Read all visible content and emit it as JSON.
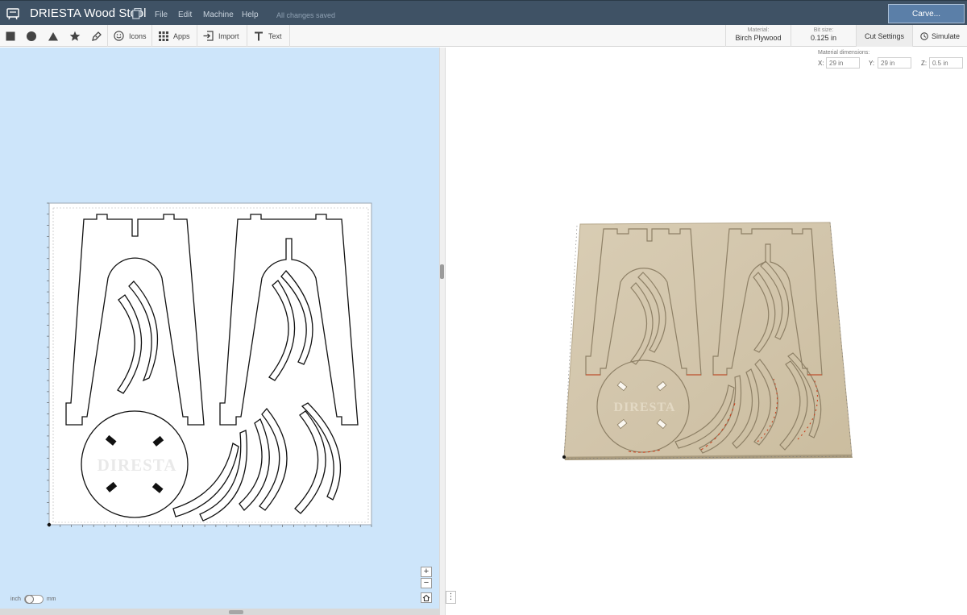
{
  "app": {
    "title": "DRIESTA Wood Stool",
    "status": "All changes saved",
    "menu": [
      "File",
      "Edit",
      "Machine",
      "Help"
    ],
    "carve_label": "Carve..."
  },
  "toolbar": {
    "shapes": [
      "square-icon",
      "circle-icon",
      "triangle-icon",
      "star-icon",
      "pen-icon"
    ],
    "icons_label": "Icons",
    "apps_label": "Apps",
    "import_label": "Import",
    "text_label": "Text",
    "material_caption": "Material:",
    "material_value": "Birch Plywood",
    "bit_caption": "Bit size:",
    "bit_value": "0.125 in",
    "cut_settings_label": "Cut Settings",
    "simulate_label": "Simulate"
  },
  "material_dimensions": {
    "caption": "Material dimensions:",
    "x_label": "X:",
    "x_placeholder": "29 in",
    "y_label": "Y:",
    "y_placeholder": "29 in",
    "z_label": "Z:",
    "z_placeholder": "0.5 in"
  },
  "canvas": {
    "watermark": "DIRESTA",
    "zoom_in": "+",
    "zoom_out": "−",
    "units": {
      "left": "inch",
      "right": "mm"
    }
  },
  "preview": {
    "watermark": "DIRESTA"
  },
  "colors": {
    "titlebar": "#3f5265",
    "accent": "#5b7fa8",
    "design_bg": "#cde5fa",
    "plywood": "#d6cab1",
    "cut_highlight": "#c8431f"
  }
}
